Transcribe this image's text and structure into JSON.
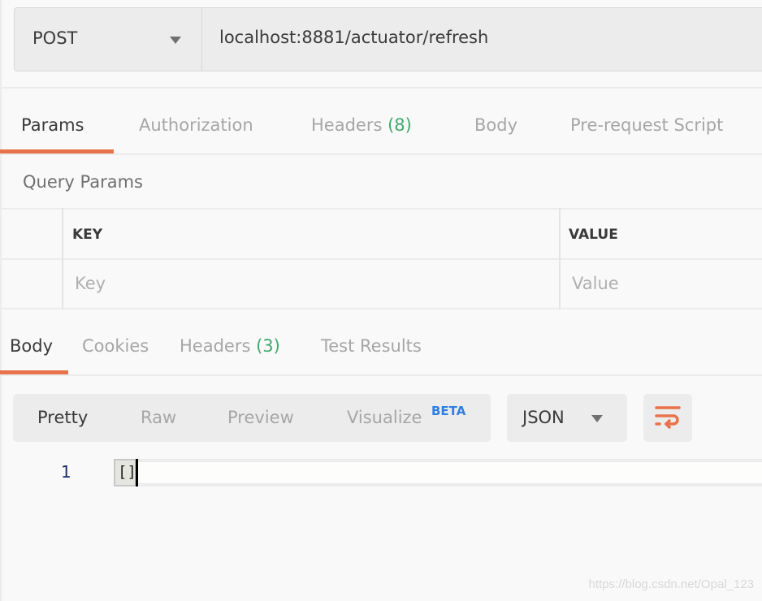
{
  "request": {
    "method": "POST",
    "url": "localhost:8881/actuator/refresh"
  },
  "request_tabs": [
    {
      "label": "Params",
      "active": true
    },
    {
      "label": "Authorization"
    },
    {
      "label": "Headers",
      "count": "(8)"
    },
    {
      "label": "Body"
    },
    {
      "label": "Pre-request Script"
    }
  ],
  "query_params": {
    "title": "Query Params",
    "key_header": "KEY",
    "value_header": "VALUE",
    "key_placeholder": "Key",
    "value_placeholder": "Value"
  },
  "response_tabs": [
    {
      "label": "Body",
      "active": true
    },
    {
      "label": "Cookies"
    },
    {
      "label": "Headers",
      "count": "(3)"
    },
    {
      "label": "Test Results"
    }
  ],
  "view_modes": {
    "pretty": "Pretty",
    "raw": "Raw",
    "preview": "Preview",
    "visualize": "Visualize",
    "beta": "BETA",
    "format": "JSON"
  },
  "code": {
    "line_number": "1",
    "content": "[]"
  },
  "watermark": "https://blog.csdn.net/Opal_123",
  "colors": {
    "accent": "#e8734a",
    "count": "#3faa6d",
    "beta": "#2f7fe6"
  }
}
